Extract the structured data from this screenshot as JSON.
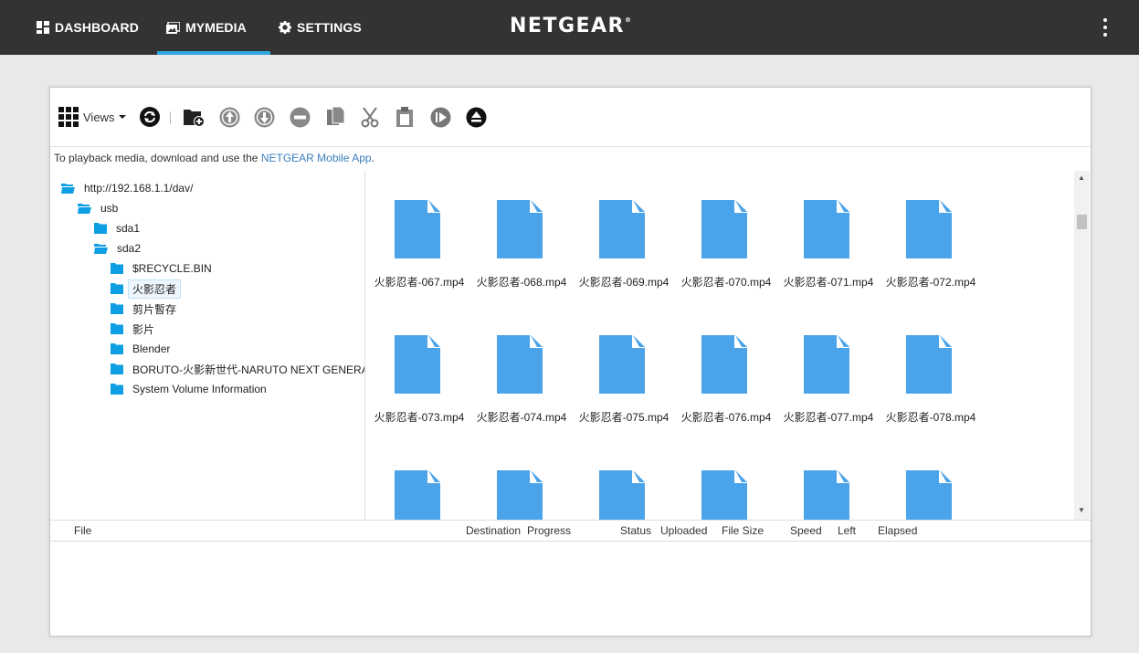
{
  "nav": {
    "dashboard": "DASHBOARD",
    "mymedia": "MYMEDIA",
    "settings": "SETTINGS",
    "brand": "NETGEAR",
    "brand_mark": "®"
  },
  "toolbar": {
    "views_label": "Views",
    "icons": [
      "grid-icon",
      "refresh-icon",
      "new-folder-icon",
      "upload-icon",
      "download-icon",
      "delete-icon",
      "copy-icon",
      "cut-icon",
      "paste-icon",
      "play-icon",
      "eject-icon"
    ]
  },
  "hint": {
    "prefix": "To playback media, download and use the ",
    "link": "NETGEAR Mobile App",
    "suffix": "."
  },
  "tree": [
    {
      "label": "http://192.168.1.1/dav/",
      "open": true
    },
    {
      "label": "usb",
      "open": true
    },
    {
      "label": "sda1",
      "open": false
    },
    {
      "label": "sda2",
      "open": true
    },
    {
      "label": "$RECYCLE.BIN",
      "open": false
    },
    {
      "label": "火影忍者",
      "open": false,
      "selected": true
    },
    {
      "label": "剪片暫存",
      "open": false
    },
    {
      "label": "影片",
      "open": false
    },
    {
      "label": "Blender",
      "open": false
    },
    {
      "label": "BORUTO-火影新世代-NARUTO NEXT GENERATIONS",
      "open": false
    },
    {
      "label": "System Volume Information",
      "open": false
    }
  ],
  "files": [
    "火影忍者-067.mp4",
    "火影忍者-068.mp4",
    "火影忍者-069.mp4",
    "火影忍者-070.mp4",
    "火影忍者-071.mp4",
    "火影忍者-072.mp4",
    "火影忍者-073.mp4",
    "火影忍者-074.mp4",
    "火影忍者-075.mp4",
    "火影忍者-076.mp4",
    "火影忍者-077.mp4",
    "火影忍者-078.mp4",
    "",
    "",
    "",
    "",
    "",
    ""
  ],
  "queue_columns": {
    "file": "File",
    "destination": "Destination",
    "progress": "Progress",
    "status": "Status",
    "uploaded": "Uploaded",
    "file_size": "File Size",
    "speed": "Speed",
    "left": "Left",
    "elapsed": "Elapsed"
  },
  "colors": {
    "topbar": "#333333",
    "accent": "#2ea7e0",
    "folder": "#0e9ee3",
    "file_icon": "#4ba3ea",
    "link": "#3a7ebd"
  }
}
